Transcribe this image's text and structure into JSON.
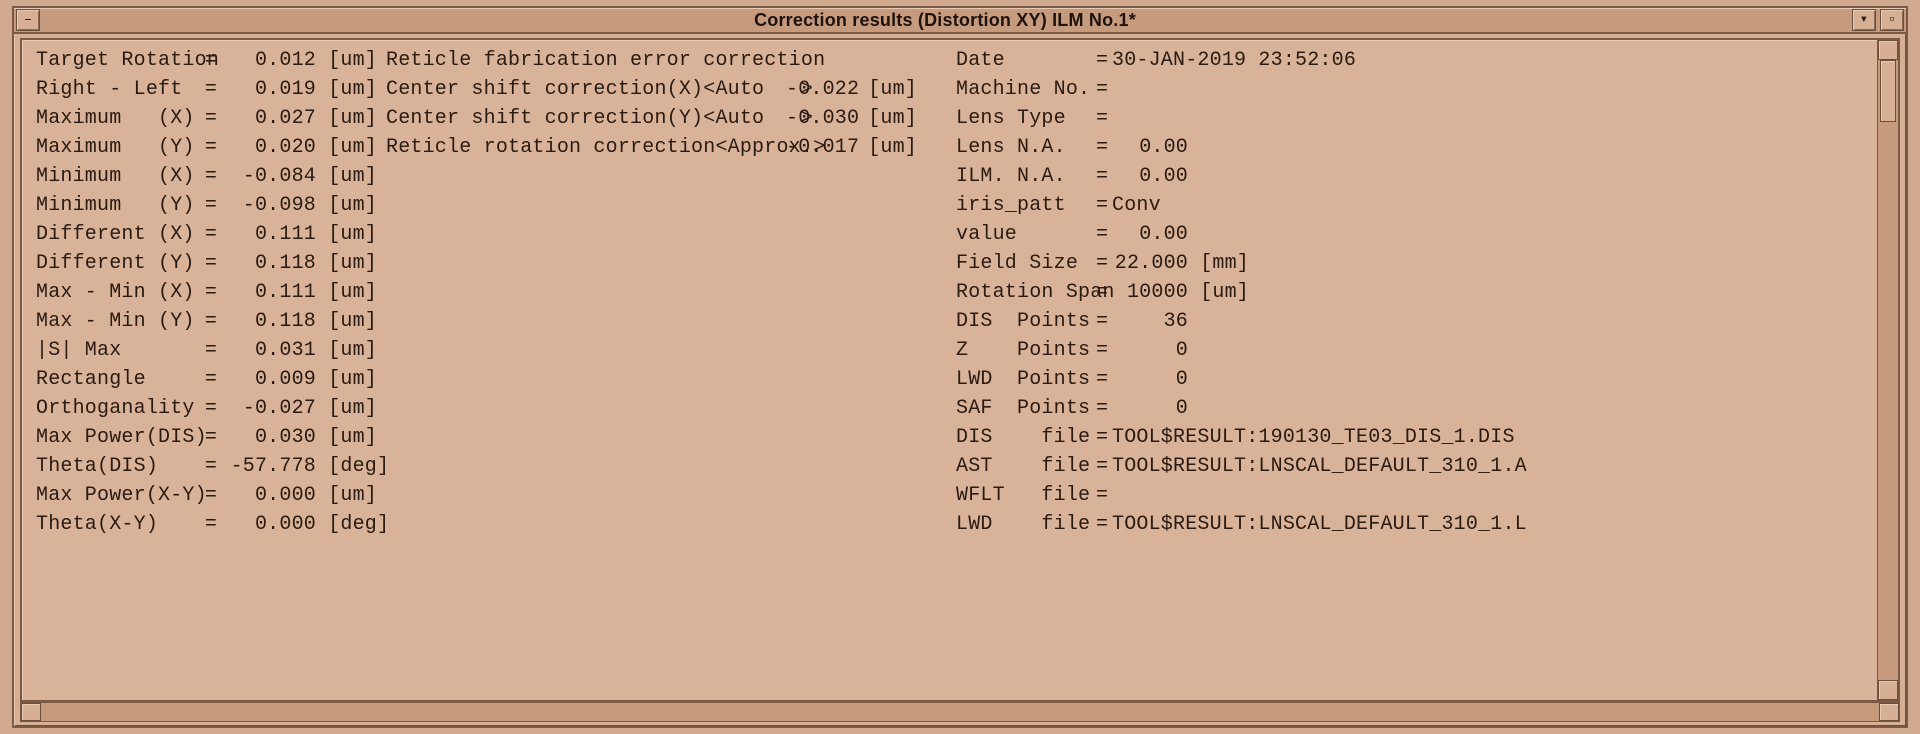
{
  "title": "Correction results (Distortion XY) ILM No.1*",
  "left": [
    {
      "label": "Target Rotation",
      "eq": "=",
      "val": "0.012",
      "unit": "[um]"
    },
    {
      "label": "Right - Left",
      "eq": "=",
      "val": "0.019",
      "unit": "[um]"
    },
    {
      "label": "Maximum   (X)",
      "eq": "=",
      "val": "0.027",
      "unit": "[um]"
    },
    {
      "label": "Maximum   (Y)",
      "eq": "=",
      "val": "0.020",
      "unit": "[um]"
    },
    {
      "label": "Minimum   (X)",
      "eq": "=",
      "val": "-0.084",
      "unit": "[um]"
    },
    {
      "label": "Minimum   (Y)",
      "eq": "=",
      "val": "-0.098",
      "unit": "[um]"
    },
    {
      "label": "Different (X)",
      "eq": "=",
      "val": "0.111",
      "unit": "[um]"
    },
    {
      "label": "Different (Y)",
      "eq": "=",
      "val": "0.118",
      "unit": "[um]"
    },
    {
      "label": "Max - Min (X)",
      "eq": "=",
      "val": "0.111",
      "unit": "[um]"
    },
    {
      "label": "Max - Min (Y)",
      "eq": "=",
      "val": "0.118",
      "unit": "[um]"
    },
    {
      "label": "|S| Max",
      "eq": "=",
      "val": "0.031",
      "unit": "[um]"
    },
    {
      "label": "Rectangle",
      "eq": "=",
      "val": "0.009",
      "unit": "[um]"
    },
    {
      "label": "Orthoganality",
      "eq": "=",
      "val": "-0.027",
      "unit": "[um]"
    },
    {
      "label": "Max Power(DIS)",
      "eq": "=",
      "val": "0.030",
      "unit": "[um]"
    },
    {
      "label": "Theta(DIS)",
      "eq": "=",
      "val": "-57.778",
      "unit": "[deg]"
    },
    {
      "label": "Max Power(X-Y)",
      "eq": "=",
      "val": "0.000",
      "unit": "[um]"
    },
    {
      "label": "Theta(X-Y)",
      "eq": "=",
      "val": "0.000",
      "unit": "[deg]"
    }
  ],
  "middle": [
    {
      "label": "Reticle fabrication error correction",
      "val": "",
      "unit": ""
    },
    {
      "label": "Center shift correction(X)<Auto   >",
      "val": "-0.022",
      "unit": "[um]"
    },
    {
      "label": "Center shift correction(Y)<Auto   >",
      "val": "-0.030",
      "unit": "[um]"
    },
    {
      "label": "Reticle rotation correction<Approx.>",
      "val": "-0.017",
      "unit": "[um]"
    }
  ],
  "right": [
    {
      "label": "Date",
      "eq": "=",
      "val": "30-JAN-2019 23:52:06"
    },
    {
      "label": "Machine No.",
      "eq": "=",
      "val": ""
    },
    {
      "label": "Lens Type",
      "eq": "=",
      "val": ""
    },
    {
      "label": "Lens N.A.",
      "eq": "=",
      "num": "0.00"
    },
    {
      "label": "ILM. N.A.",
      "eq": "=",
      "num": "0.00"
    },
    {
      "label": "iris_patt",
      "eq": "=",
      "val": "Conv"
    },
    {
      "label": "value",
      "eq": "=",
      "num": "0.00"
    },
    {
      "label": "Field Size",
      "eq": "=",
      "num": "22.000",
      "unit": "[mm]"
    },
    {
      "label": "Rotation Span",
      "eq": "=",
      "num": "10000",
      "unit": "[um]"
    },
    {
      "label": "DIS  Points",
      "eq": "=",
      "num": "36"
    },
    {
      "label": "Z    Points",
      "eq": "=",
      "num": "0"
    },
    {
      "label": "LWD  Points",
      "eq": "=",
      "num": "0"
    },
    {
      "label": "SAF  Points",
      "eq": "=",
      "num": "0"
    },
    {
      "label": "DIS    file",
      "eq": "=",
      "val": "TOOL$RESULT:190130_TE03_DIS_1.DIS"
    },
    {
      "label": "AST    file",
      "eq": "=",
      "val": "TOOL$RESULT:LNSCAL_DEFAULT_310_1.A"
    },
    {
      "label": "WFLT   file",
      "eq": "=",
      "val": ""
    },
    {
      "label": "LWD    file",
      "eq": "=",
      "val": "TOOL$RESULT:LNSCAL_DEFAULT_310_1.L"
    }
  ]
}
